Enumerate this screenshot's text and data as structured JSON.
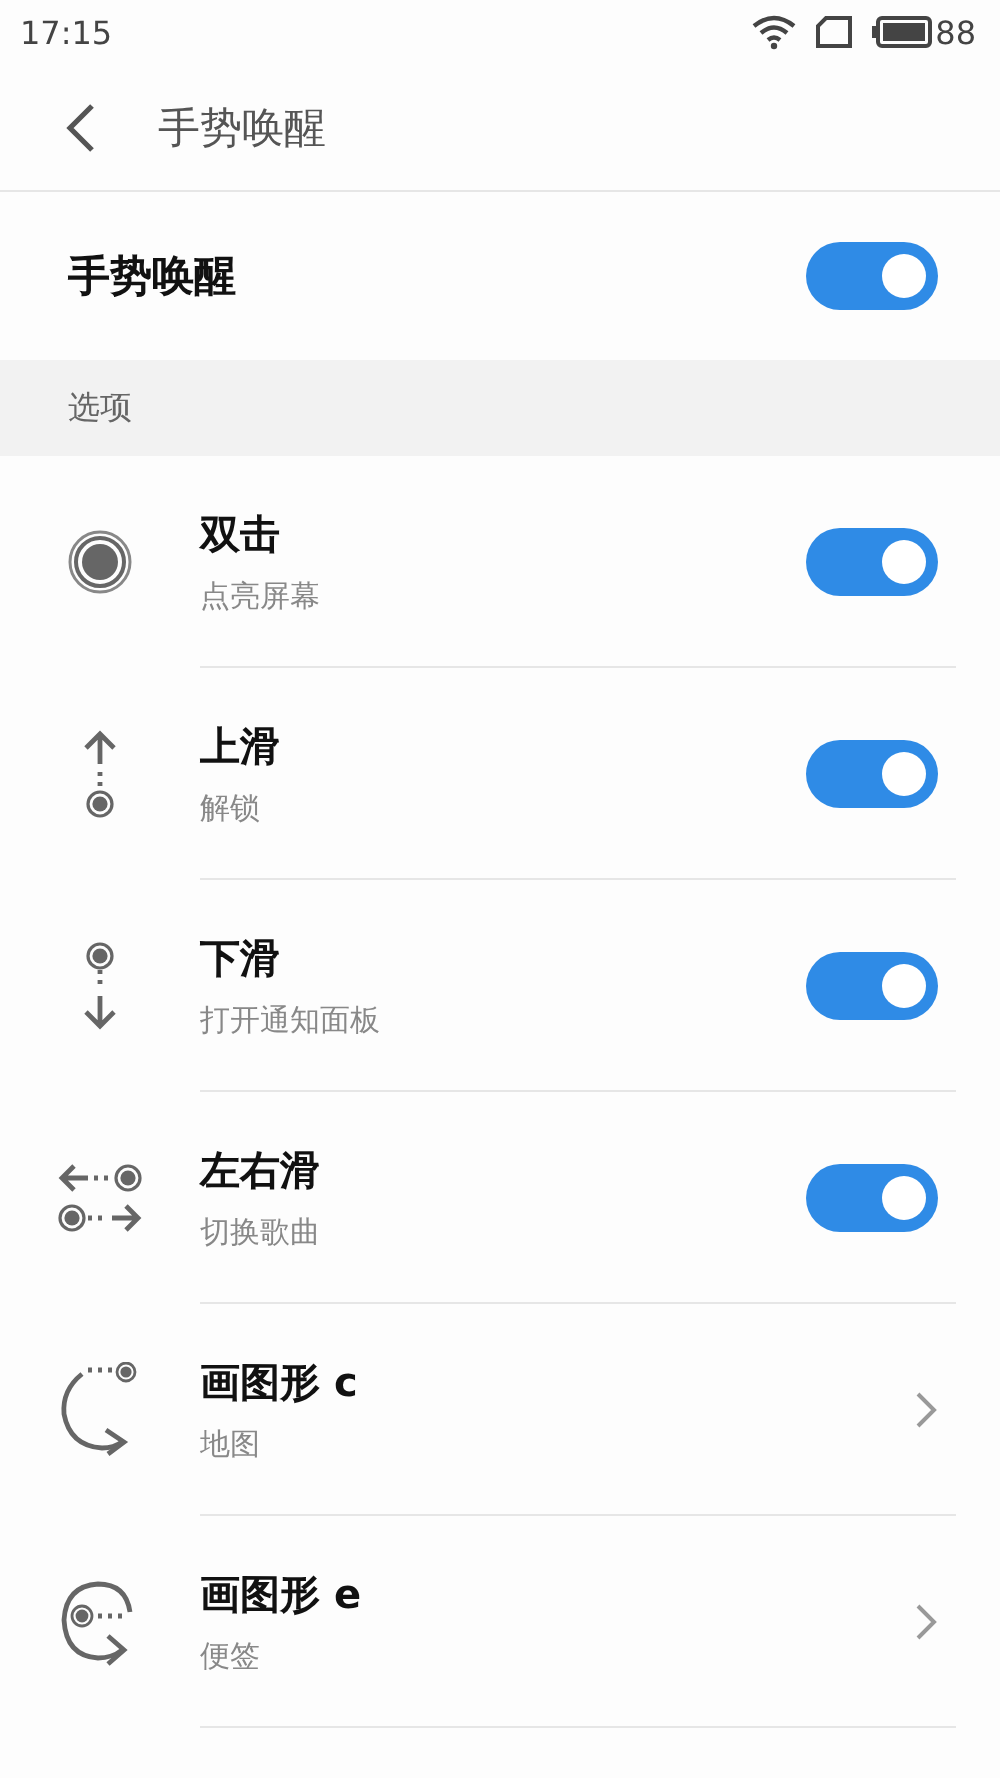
{
  "status_bar": {
    "time": "17:15",
    "battery": "88"
  },
  "header": {
    "title": "手势唤醒"
  },
  "master": {
    "label": "手势唤醒",
    "on": true
  },
  "section": {
    "title": "选项"
  },
  "items": [
    {
      "kind": "toggle",
      "title": "双击",
      "subtitle": "点亮屏幕",
      "on": true
    },
    {
      "kind": "toggle",
      "title": "上滑",
      "subtitle": "解锁",
      "on": true
    },
    {
      "kind": "toggle",
      "title": "下滑",
      "subtitle": "打开通知面板",
      "on": true
    },
    {
      "kind": "toggle",
      "title": "左右滑",
      "subtitle": "切换歌曲",
      "on": true
    },
    {
      "kind": "link",
      "title": "画图形 c",
      "subtitle": "地图"
    },
    {
      "kind": "link",
      "title": "画图形 e",
      "subtitle": "便签"
    }
  ]
}
